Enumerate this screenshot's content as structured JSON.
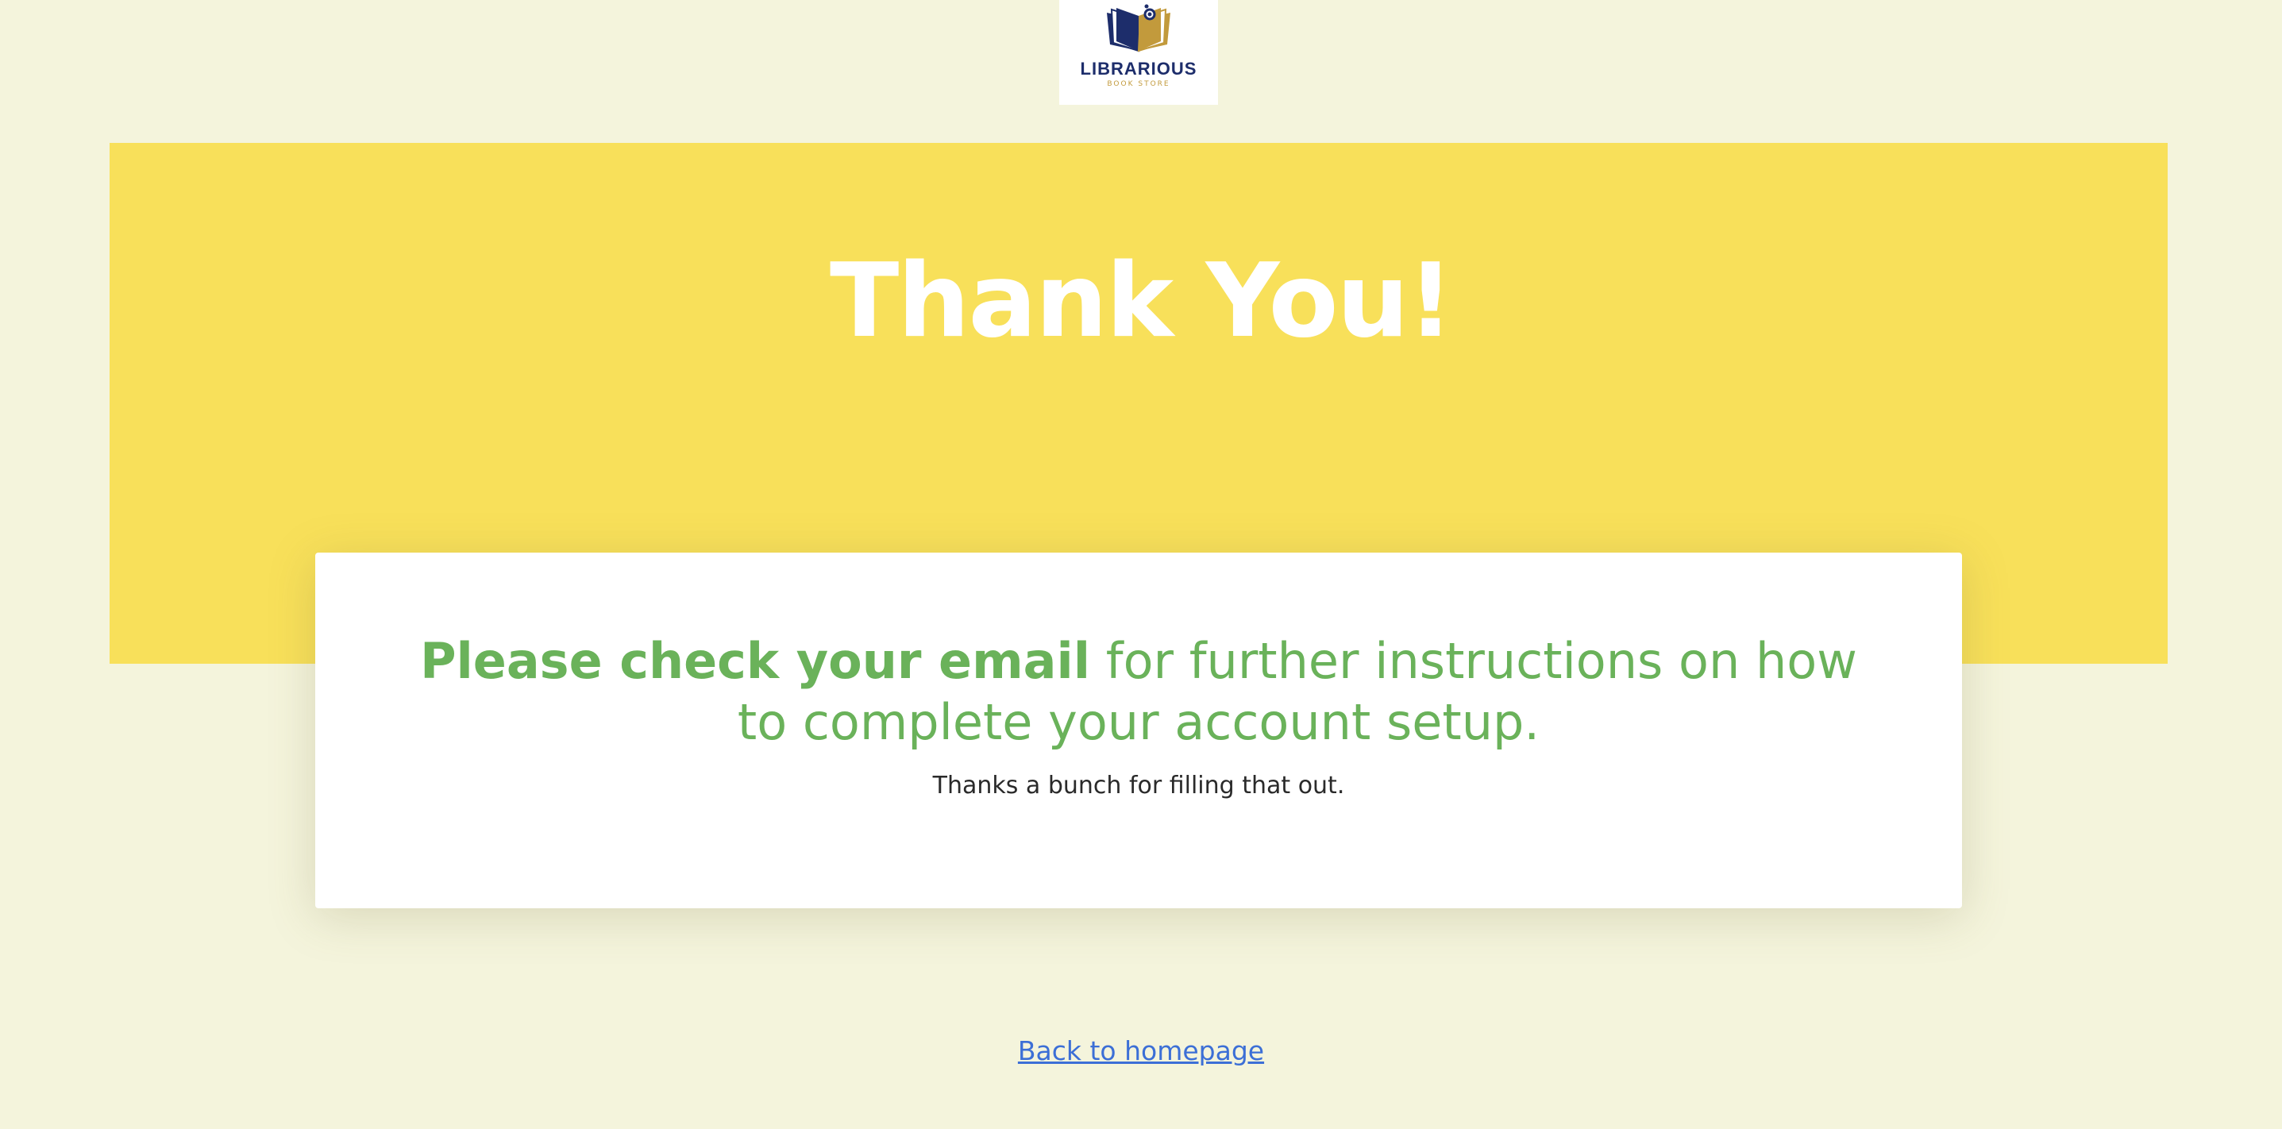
{
  "logo": {
    "name": "LIBRARIOUS",
    "tagline": "BOOK STORE",
    "icon": "open-book-icon"
  },
  "hero": {
    "title": "Thank You!"
  },
  "card": {
    "heading_bold": "Please check your email",
    "heading_rest": " for further instructions on how to complete your account setup.",
    "subtext": "Thanks a bunch for filling that out."
  },
  "footer": {
    "back_link": "Back to homepage"
  },
  "colors": {
    "page_background": "#f4f4dc",
    "hero_background": "#f8e05a",
    "heading_green": "#6ab25a",
    "link_blue": "#3c6fd6",
    "logo_navy": "#1d2d6b",
    "logo_gold": "#c29a3c"
  }
}
